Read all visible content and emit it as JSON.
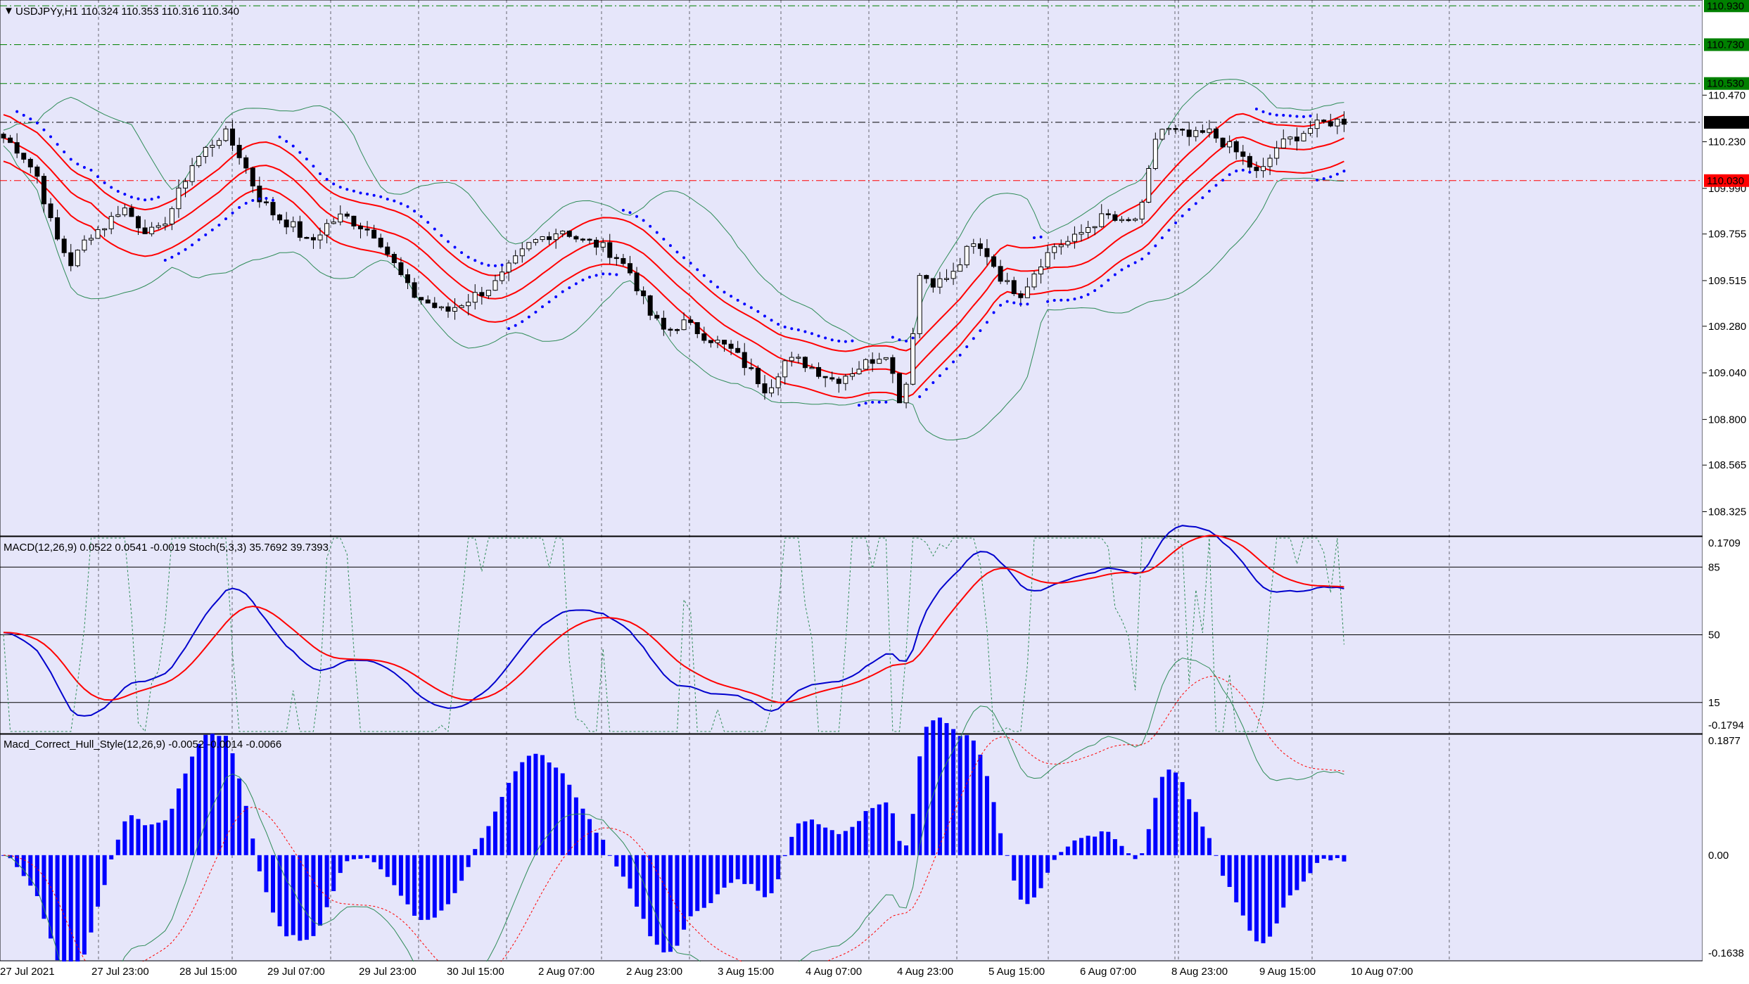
{
  "window": {
    "symbol_header": "USDJPYy,H1  110.324 110.353 110.316 110.340",
    "menu_icon": "triangle-down-icon"
  },
  "colors": {
    "background": "#e6e6fa",
    "candle_up": "#ffffff",
    "candle_down": "#000000",
    "envelope": "#ff0000",
    "bollinger": "#2e8b57",
    "parabolic_sar": "#0000ff",
    "macd_main": "#0000cd",
    "macd_signal": "#ff0000",
    "stoch": "#2e8b57",
    "hull_hist": "#0000ff",
    "level_green": "#008000",
    "level_red": "#ff0000",
    "current_price_bg": "#000000"
  },
  "price_axis": {
    "ticks": [
      "110.470",
      "110.230",
      "109.990",
      "109.755",
      "109.515",
      "109.280",
      "109.040",
      "108.800",
      "108.565",
      "108.325"
    ],
    "levels": [
      {
        "label": "110.930",
        "color": "#008000",
        "value": 110.93
      },
      {
        "label": "110.730",
        "color": "#008000",
        "value": 110.73
      },
      {
        "label": "110.530",
        "color": "#008000",
        "value": 110.53
      },
      {
        "label": "110.330",
        "color": "#000000",
        "value": 110.33
      },
      {
        "label": "110.030",
        "color": "#ff0000",
        "value": 110.03
      }
    ]
  },
  "time_axis": [
    "27 Jul 2021",
    "27 Jul 23:00",
    "28 Jul 15:00",
    "29 Jul 07:00",
    "29 Jul 23:00",
    "30 Jul 15:00",
    "2 Aug 07:00",
    "2 Aug 23:00",
    "3 Aug 15:00",
    "4 Aug 07:00",
    "4 Aug 23:00",
    "5 Aug 15:00",
    "6 Aug 07:00",
    "8 Aug 23:00",
    "9 Aug 15:00",
    "10 Aug 07:00"
  ],
  "macd_panel": {
    "header": "MACD(12,26,9) 0.0522 0.0541 -0.0019  Stoch(5,3,3) 35.7692 39.7393",
    "ticks": [
      "0.1709",
      "-0.1794"
    ],
    "levels": [
      "85",
      "50",
      "15"
    ]
  },
  "hull_panel": {
    "header": "Macd_Correct_Hull_Style(12,26,9) -0.0052 -0.0014 -0.0066",
    "ticks": [
      "0.1877",
      "0.00",
      "-0.1638"
    ]
  },
  "chart_data": {
    "type": "candlestick",
    "symbol": "USDJPYy",
    "timeframe": "H1",
    "open": 110.324,
    "high": 110.353,
    "low": 110.316,
    "close": 110.34,
    "ylim": [
      108.2,
      110.96
    ],
    "x_ticks": [
      "27 Jul 2021",
      "27 Jul 23:00",
      "28 Jul 15:00",
      "29 Jul 07:00",
      "29 Jul 23:00",
      "30 Jul 15:00",
      "2 Aug 07:00",
      "2 Aug 23:00",
      "3 Aug 15:00",
      "4 Aug 07:00",
      "4 Aug 23:00",
      "5 Aug 15:00",
      "6 Aug 07:00",
      "8 Aug 23:00",
      "9 Aug 15:00",
      "10 Aug 07:00"
    ],
    "close_path": [
      110.25,
      110.18,
      110.05,
      109.75,
      109.6,
      109.75,
      109.8,
      109.9,
      109.8,
      109.75,
      109.9,
      110.1,
      110.2,
      110.28,
      110.15,
      109.95,
      109.85,
      109.8,
      109.7,
      109.8,
      109.85,
      109.8,
      109.75,
      109.6,
      109.45,
      109.4,
      109.35,
      109.4,
      109.45,
      109.5,
      109.6,
      109.7,
      109.75,
      109.78,
      109.72,
      109.7,
      109.65,
      109.55,
      109.35,
      109.25,
      109.3,
      109.25,
      109.2,
      109.15,
      109.05,
      108.95,
      109.1,
      109.1,
      109.05,
      109.0,
      109.05,
      109.1,
      109.15,
      108.85,
      109.55,
      109.5,
      109.55,
      109.7,
      109.65,
      109.5,
      109.45,
      109.6,
      109.7,
      109.72,
      109.8,
      109.85,
      109.8,
      109.85,
      110.3,
      110.28,
      110.25,
      110.28,
      110.22,
      110.15,
      110.05,
      110.2,
      110.25,
      110.3,
      110.33,
      110.34
    ],
    "stochastic": {
      "k": 35.7692,
      "d": 39.7393,
      "levels": [
        85,
        50,
        15
      ]
    },
    "macd": {
      "main": 0.0522,
      "signal": 0.0541,
      "hist": -0.0019,
      "ylim": [
        -0.1794,
        0.1709
      ]
    },
    "hull_macd": {
      "v1": -0.0052,
      "v2": -0.0014,
      "v3": -0.0066,
      "ylim": [
        -0.1638,
        0.1877
      ]
    }
  }
}
